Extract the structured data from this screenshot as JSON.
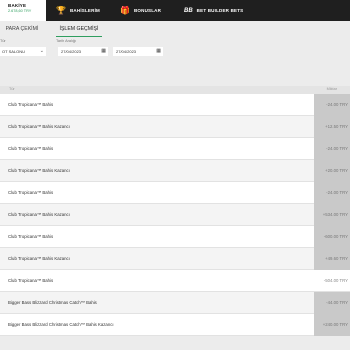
{
  "balance": {
    "title": "BAKİYE",
    "value": "2.678,60 TRY"
  },
  "top_nav": [
    {
      "icon": "trophy-icon",
      "glyph": "🏆",
      "label": "BAHİSLERİM"
    },
    {
      "icon": "gift-icon",
      "glyph": "🎁",
      "label": "BONUSLAR"
    },
    {
      "icon": "bet-builder-icon",
      "glyph": "BB",
      "label": "BET BUILDER BETS"
    }
  ],
  "tabs": {
    "withdraw": "PARA ÇEKİMİ",
    "history": "İŞLEM GEÇMİŞİ"
  },
  "filters": {
    "type_label": "Tür",
    "type_value": "OT SALONU",
    "date_label": "Tarih Aralığı",
    "date_from": "27/04/2023",
    "date_to": "27/04/2023"
  },
  "table": {
    "col_type": "Tür",
    "col_amount": "Miktar"
  },
  "rows": [
    {
      "desc": "Club Tropicana™ Bahis",
      "amount": "-24.00 TRY"
    },
    {
      "desc": "Club Tropicana™ Bahis Kazancı",
      "amount": "+12.50 TRY"
    },
    {
      "desc": "Club Tropicana™ Bahis",
      "amount": "-24.00 TRY"
    },
    {
      "desc": "Club Tropicana™ Bahis Kazancı",
      "amount": "+20.00 TRY"
    },
    {
      "desc": "Club Tropicana™ Bahis",
      "amount": "-24.00 TRY"
    },
    {
      "desc": "Club Tropicana™ Bahis Kazancı",
      "amount": "+534.00 TRY"
    },
    {
      "desc": "Club Tropicana™ Bahis",
      "amount": "-600.00 TRY"
    },
    {
      "desc": "Club Tropicana™ Bahis Kazancı",
      "amount": "+49.60 TRY"
    },
    {
      "desc": "Club Tropicana™ Bahis",
      "amount": "-504.00 TRY"
    },
    {
      "desc": "Bigger Bass Blizzard Christmas Catch™ Bahis",
      "amount": "-44.00 TRY"
    },
    {
      "desc": "Bigger Bass Blizzard Christmas Catch™ Bahis Kazancı",
      "amount": "+240.00 TRY"
    }
  ]
}
